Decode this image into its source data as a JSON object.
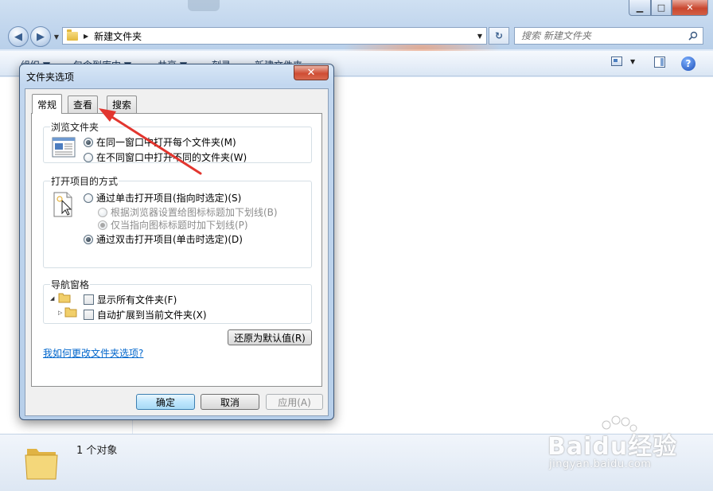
{
  "window": {
    "title_path": "新建文件夹",
    "search_placeholder": "搜索 新建文件夹",
    "caption": {
      "minimize": "▁",
      "maximize": "□",
      "close": "✕"
    },
    "nav": {
      "back": "◀",
      "forward": "▶",
      "dropdown": "▼"
    },
    "address_chevron": "▶",
    "address_dropdown": "▼",
    "refresh": "↻",
    "command_bar": {
      "organize": "组织 ▼",
      "include_in_library": "包含到库中 ▼",
      "share": "共享 ▼",
      "burn": "刻录",
      "new_folder": "新建文件夹",
      "view_dropdown": "▼",
      "help": "?"
    },
    "status_text": "1 个对象",
    "watermark": {
      "brand": "Baidu经验",
      "url": "jingyan.baidu.com"
    }
  },
  "dialog": {
    "title": "文件夹选项",
    "close": "✕",
    "tabs": [
      {
        "label": "常规",
        "active": true
      },
      {
        "label": "查看",
        "active": false
      },
      {
        "label": "搜索",
        "active": false
      }
    ],
    "browse_group": {
      "label": "浏览文件夹",
      "options": [
        {
          "label": "在同一窗口中打开每个文件夹(M)",
          "checked": true
        },
        {
          "label": "在不同窗口中打开不同的文件夹(W)",
          "checked": false
        }
      ]
    },
    "click_group": {
      "label": "打开项目的方式",
      "options": [
        {
          "label": "通过单击打开项目(指向时选定)(S)",
          "checked": false,
          "disabled": false
        },
        {
          "label": "根据浏览器设置给图标标题加下划线(B)",
          "checked": false,
          "disabled": true
        },
        {
          "label": "仅当指向图标标题时加下划线(P)",
          "checked": true,
          "disabled": true
        },
        {
          "label": "通过双击打开项目(单击时选定)(D)",
          "checked": true,
          "disabled": false
        }
      ]
    },
    "nav_group": {
      "label": "导航窗格",
      "options": [
        {
          "label": "显示所有文件夹(F)",
          "checked": false
        },
        {
          "label": "自动扩展到当前文件夹(X)",
          "checked": false
        }
      ]
    },
    "restore_button": "还原为默认值(R)",
    "help_link": "我如何更改文件夹选项?",
    "ok_button": "确定",
    "cancel_button": "取消",
    "apply_button": "应用(A)"
  },
  "colors": {
    "annotation_arrow": "#e2362f",
    "link": "#0066cc",
    "default_button": "#3c7fb1"
  }
}
